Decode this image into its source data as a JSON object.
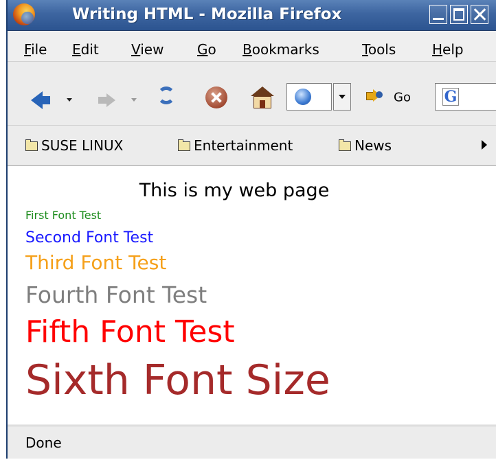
{
  "window": {
    "title": "Writing HTML - Mozilla Firefox"
  },
  "menu": {
    "items": [
      {
        "label": "File",
        "mnemonic": "F",
        "rest": "ile"
      },
      {
        "label": "Edit",
        "mnemonic": "E",
        "rest": "dit"
      },
      {
        "label": "View",
        "mnemonic": "V",
        "rest": "iew"
      },
      {
        "label": "Go",
        "mnemonic": "G",
        "rest": "o"
      },
      {
        "label": "Bookmarks",
        "mnemonic": "B",
        "rest": "ookmarks"
      },
      {
        "label": "Tools",
        "mnemonic": "T",
        "rest": "ools"
      },
      {
        "label": "Help",
        "mnemonic": "H",
        "rest": "elp"
      }
    ]
  },
  "toolbar": {
    "go_label": "Go",
    "search_engine_icon": "google-g-icon",
    "icons": [
      "back-arrow-icon",
      "forward-arrow-icon",
      "reload-icon",
      "stop-icon",
      "home-icon",
      "page-globe-icon",
      "go-arrow-icon"
    ]
  },
  "bookmarks": {
    "items": [
      {
        "label": "SUSE LINUX",
        "icon": "folder-icon"
      },
      {
        "label": "Entertainment",
        "icon": "folder-icon"
      },
      {
        "label": "News",
        "icon": "folder-icon"
      }
    ]
  },
  "page": {
    "heading": "This is my web page",
    "lines": [
      {
        "text": "First Font Test",
        "color": "#1c8c1c"
      },
      {
        "text": "Second Font Test",
        "color": "#1a1aff"
      },
      {
        "text": "Third Font Test",
        "color": "#f5a01a"
      },
      {
        "text": "Fourth Font Test",
        "color": "#7e7e7e"
      },
      {
        "text": "Fifth Font Test",
        "color": "#ff0000"
      },
      {
        "text": "Sixth Font Size",
        "color": "#a52a2a"
      }
    ]
  },
  "status": {
    "text": "Done"
  },
  "colors": {
    "titlebar": "#3d65a0",
    "chrome": "#ececec"
  }
}
